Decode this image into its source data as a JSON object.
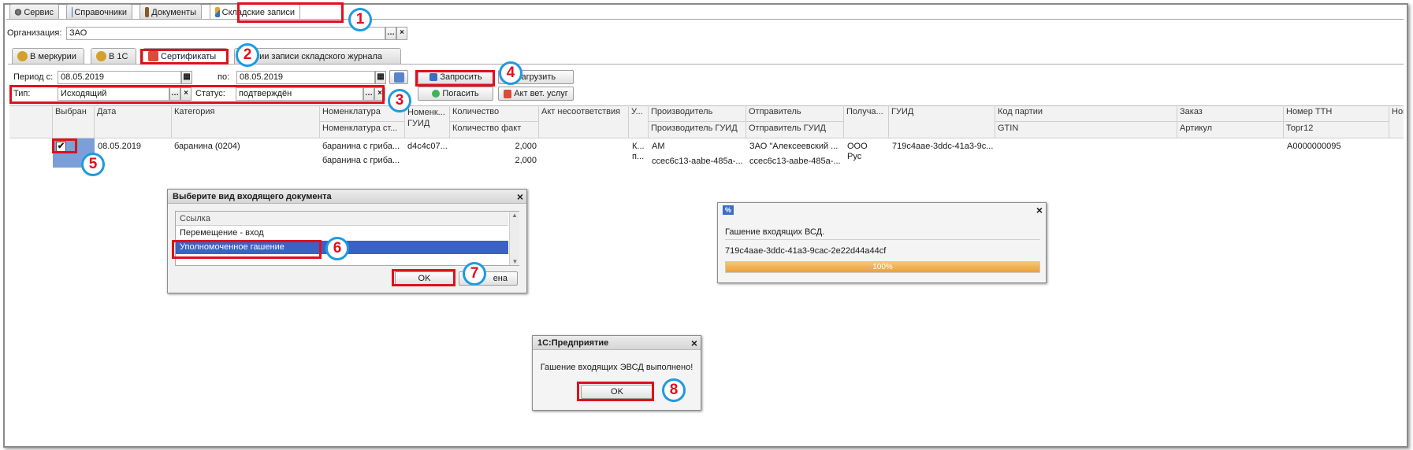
{
  "top_tabs": [
    {
      "label": "Сервис",
      "icon": "gear-icon"
    },
    {
      "label": "Справочники",
      "icon": "catalog-icon"
    },
    {
      "label": "Документы",
      "icon": "briefcase-icon"
    },
    {
      "label": "Складские записи",
      "icon": "warehouse-icon"
    }
  ],
  "org": {
    "label": "Организация:",
    "value": "ЗАО"
  },
  "sub_tabs": [
    {
      "label": "В меркурии"
    },
    {
      "label": "В 1С"
    },
    {
      "label": "Сертификаты"
    },
    {
      "label": "Версии записи складского журнала"
    }
  ],
  "filters": {
    "period_from_label": "Период с:",
    "period_from_value": "08.05.2019",
    "period_to_label": "по:",
    "period_to_value": "08.05.2019",
    "type_label": "Тип:",
    "type_value": "Исходящий",
    "status_label": "Статус:",
    "status_value": "подтверждён"
  },
  "buttons": {
    "request": "Запросить",
    "load": "Загрузить",
    "redeem": "Погасить",
    "vet_act": "Акт вет. услуг"
  },
  "table": {
    "headers_top": [
      "Выбран",
      "Дата",
      "Категория",
      "Номенклатура",
      "Номенк...",
      "Количество",
      "Акт несоответствия",
      "У...",
      "Производитель",
      "Отправитель",
      "Получа...",
      "ГУИД",
      "Код партии",
      "Заказ",
      "Номер ТТН",
      "Ном"
    ],
    "headers_bottom": [
      "Номенклатура ст...",
      "ГУИД",
      "Количество факт",
      "Производитель ГУИД",
      "Отправитель ГУИД",
      "GTIN",
      "Артикул",
      "Торг12"
    ],
    "row": {
      "date": "08.05.2019",
      "category": "баранина (0204)",
      "nom1": "баранина с гриба...",
      "nom2": "баранина с гриба...",
      "guid_short": "d4c4c07...",
      "qty": "2,000",
      "qty_fact": "2,000",
      "unit1": "К...",
      "unit2": "п...",
      "producer": "АМ",
      "producer_guid": "ccec6c13-aabe-485a-...",
      "sender": "ЗАО \"Алексеевский ...",
      "sender_guid": "ccec6c13-aabe-485a-...",
      "recv1": "ООО",
      "recv2": "Рус",
      "guid": "719c4aae-3ddc-41a3-9c...",
      "ttn": "A0000000095"
    }
  },
  "dialog_choose": {
    "title": "Выберите вид входящего документа",
    "column": "Ссылка",
    "items": [
      "Перемещение - вход",
      "Уполномоченное гашение"
    ],
    "ok": "OK",
    "cancel": "Отмена",
    "cancel_visible": "ена"
  },
  "progress": {
    "title_icon": "%",
    "heading": "Гашение входящих ВСД.",
    "guid": "719c4aae-3ddc-41a3-9cac-2e22d44a44cf",
    "percent": 100,
    "percent_text": "100%"
  },
  "msgbox": {
    "title": "1С:Предприятие",
    "text": "Гашение входящих ЭВСД выполнено!",
    "ok": "OK"
  },
  "badges": [
    "1",
    "2",
    "3",
    "4",
    "5",
    "6",
    "7",
    "8"
  ],
  "colors": {
    "annotation_red": "#e0101c",
    "annotation_blue": "#1e9be0",
    "selection": "#3c61c4",
    "progress": "#f0a030"
  }
}
